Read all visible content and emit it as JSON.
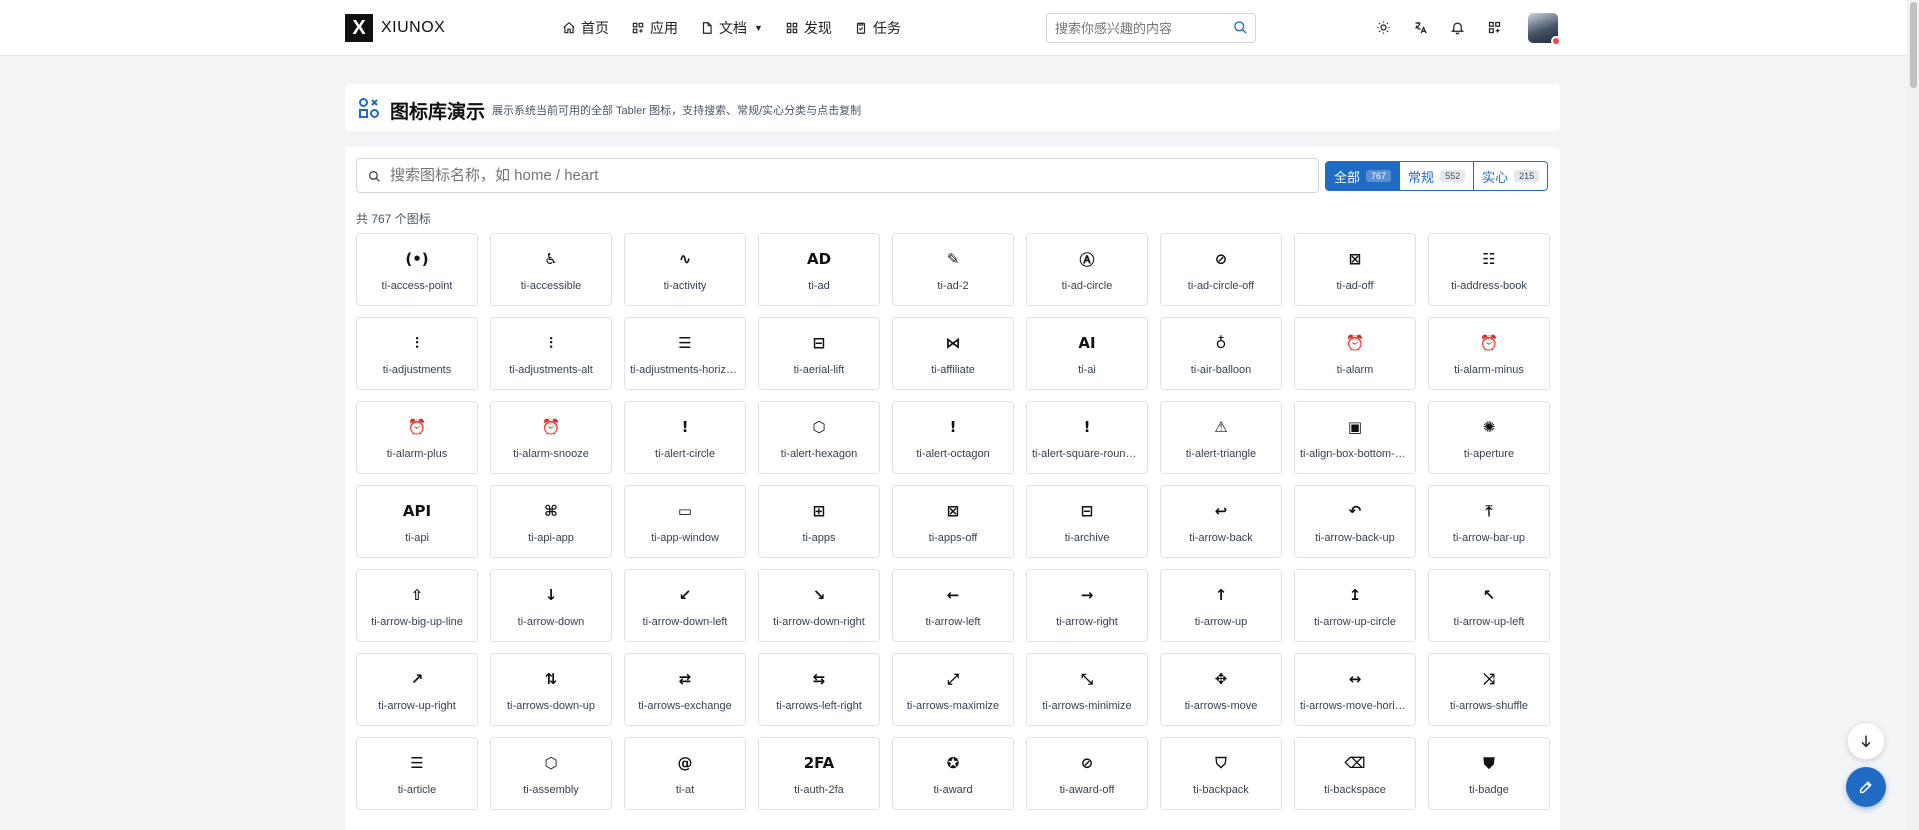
{
  "app": {
    "logo_letter": "X",
    "name": "XIUNOX"
  },
  "nav": {
    "items": [
      {
        "label": "首页",
        "icon": "home-icon"
      },
      {
        "label": "应用",
        "icon": "apps-icon"
      },
      {
        "label": "文档",
        "icon": "file-icon",
        "has_caret": true
      },
      {
        "label": "发现",
        "icon": "grid-icon"
      },
      {
        "label": "任务",
        "icon": "clipboard-icon"
      }
    ]
  },
  "top_search": {
    "placeholder": "搜索你感兴趣的内容"
  },
  "toolbar_icons": [
    "sun-icon",
    "language-icon",
    "bell-icon",
    "apps-icon"
  ],
  "header": {
    "title": "图标库演示",
    "description": "展示系统当前可用的全部 Tabler 图标，支持搜索、常规/实心分类与点击复制"
  },
  "icon_search": {
    "placeholder": "搜索图标名称，如 home / heart"
  },
  "filters": [
    {
      "label": "全部",
      "count": "767",
      "active": true
    },
    {
      "label": "常规",
      "count": "552",
      "active": false
    },
    {
      "label": "实心",
      "count": "215",
      "active": false
    }
  ],
  "count_text": "共 767 个图标",
  "icons": [
    {
      "name": "ti-access-point",
      "glyph": "(•)"
    },
    {
      "name": "ti-accessible",
      "glyph": "♿"
    },
    {
      "name": "ti-activity",
      "glyph": "∿"
    },
    {
      "name": "ti-ad",
      "glyph": "AD"
    },
    {
      "name": "ti-ad-2",
      "glyph": "✎"
    },
    {
      "name": "ti-ad-circle",
      "glyph": "Ⓐ"
    },
    {
      "name": "ti-ad-circle-off",
      "glyph": "⊘"
    },
    {
      "name": "ti-ad-off",
      "glyph": "⊠"
    },
    {
      "name": "ti-address-book",
      "glyph": "☷"
    },
    {
      "name": "ti-adjustments",
      "glyph": "⫶"
    },
    {
      "name": "ti-adjustments-alt",
      "glyph": "⫶"
    },
    {
      "name": "ti-adjustments-horizontal",
      "glyph": "☰"
    },
    {
      "name": "ti-aerial-lift",
      "glyph": "⊟"
    },
    {
      "name": "ti-affiliate",
      "glyph": "⋈"
    },
    {
      "name": "ti-ai",
      "glyph": "AI"
    },
    {
      "name": "ti-air-balloon",
      "glyph": "♁"
    },
    {
      "name": "ti-alarm",
      "glyph": "⏰"
    },
    {
      "name": "ti-alarm-minus",
      "glyph": "⏰"
    },
    {
      "name": "ti-alarm-plus",
      "glyph": "⏰"
    },
    {
      "name": "ti-alarm-snooze",
      "glyph": "⏰"
    },
    {
      "name": "ti-alert-circle",
      "glyph": "!"
    },
    {
      "name": "ti-alert-hexagon",
      "glyph": "⬡"
    },
    {
      "name": "ti-alert-octagon",
      "glyph": "!"
    },
    {
      "name": "ti-alert-square-rounded",
      "glyph": "!"
    },
    {
      "name": "ti-alert-triangle",
      "glyph": "⚠"
    },
    {
      "name": "ti-align-box-bottom-center",
      "glyph": "▣"
    },
    {
      "name": "ti-aperture",
      "glyph": "✺"
    },
    {
      "name": "ti-api",
      "glyph": "API"
    },
    {
      "name": "ti-api-app",
      "glyph": "⌘"
    },
    {
      "name": "ti-app-window",
      "glyph": "▭"
    },
    {
      "name": "ti-apps",
      "glyph": "⊞"
    },
    {
      "name": "ti-apps-off",
      "glyph": "⊠"
    },
    {
      "name": "ti-archive",
      "glyph": "⊟"
    },
    {
      "name": "ti-arrow-back",
      "glyph": "↩"
    },
    {
      "name": "ti-arrow-back-up",
      "glyph": "↶"
    },
    {
      "name": "ti-arrow-bar-up",
      "glyph": "⤒"
    },
    {
      "name": "ti-arrow-big-up-line",
      "glyph": "⇧"
    },
    {
      "name": "ti-arrow-down",
      "glyph": "↓"
    },
    {
      "name": "ti-arrow-down-left",
      "glyph": "↙"
    },
    {
      "name": "ti-arrow-down-right",
      "glyph": "↘"
    },
    {
      "name": "ti-arrow-left",
      "glyph": "←"
    },
    {
      "name": "ti-arrow-right",
      "glyph": "→"
    },
    {
      "name": "ti-arrow-up",
      "glyph": "↑"
    },
    {
      "name": "ti-arrow-up-circle",
      "glyph": "↥"
    },
    {
      "name": "ti-arrow-up-left",
      "glyph": "↖"
    },
    {
      "name": "ti-arrow-up-right",
      "glyph": "↗"
    },
    {
      "name": "ti-arrows-down-up",
      "glyph": "⇅"
    },
    {
      "name": "ti-arrows-exchange",
      "glyph": "⇄"
    },
    {
      "name": "ti-arrows-left-right",
      "glyph": "⇆"
    },
    {
      "name": "ti-arrows-maximize",
      "glyph": "⤢"
    },
    {
      "name": "ti-arrows-minimize",
      "glyph": "⤡"
    },
    {
      "name": "ti-arrows-move",
      "glyph": "✥"
    },
    {
      "name": "ti-arrows-move-horizontal",
      "glyph": "↔"
    },
    {
      "name": "ti-arrows-shuffle",
      "glyph": "⤨"
    },
    {
      "name": "ti-article",
      "glyph": "☰"
    },
    {
      "name": "ti-assembly",
      "glyph": "⬡"
    },
    {
      "name": "ti-at",
      "glyph": "@"
    },
    {
      "name": "ti-auth-2fa",
      "glyph": "2FA"
    },
    {
      "name": "ti-award",
      "glyph": "✪"
    },
    {
      "name": "ti-award-off",
      "glyph": "⊘"
    },
    {
      "name": "ti-backpack",
      "glyph": "⛉"
    },
    {
      "name": "ti-backspace",
      "glyph": "⌫"
    },
    {
      "name": "ti-badge",
      "glyph": "⛊"
    }
  ],
  "floating": {
    "scroll_down": "arrow-down-icon",
    "edit": "pencil-icon"
  },
  "colors": {
    "primary": "#206bc4",
    "page_bg": "#f3f4f6",
    "alert_dot": "#ef4444"
  }
}
